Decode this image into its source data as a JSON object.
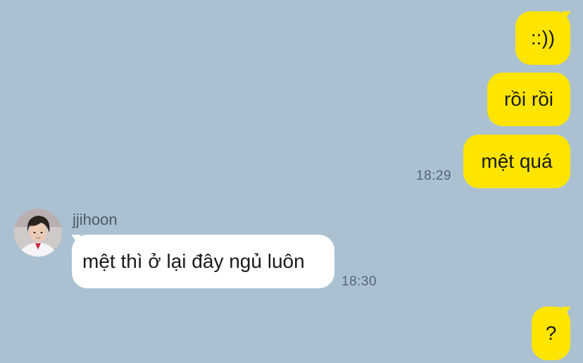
{
  "conversation": {
    "outgoing": [
      {
        "text": "::))"
      },
      {
        "text": "rồi rồi"
      },
      {
        "text": "mệt quá",
        "time": "18:29"
      },
      {
        "text": "?"
      }
    ],
    "incoming": [
      {
        "sender": "jjihoon",
        "text": "mệt thì ở lại đây ngủ luôn",
        "time": "18:30"
      }
    ]
  },
  "colors": {
    "background": "#abc1d1",
    "outgoing_bubble": "#fee500",
    "incoming_bubble": "#ffffff"
  },
  "icons": {
    "avatar": "profile-photo"
  }
}
